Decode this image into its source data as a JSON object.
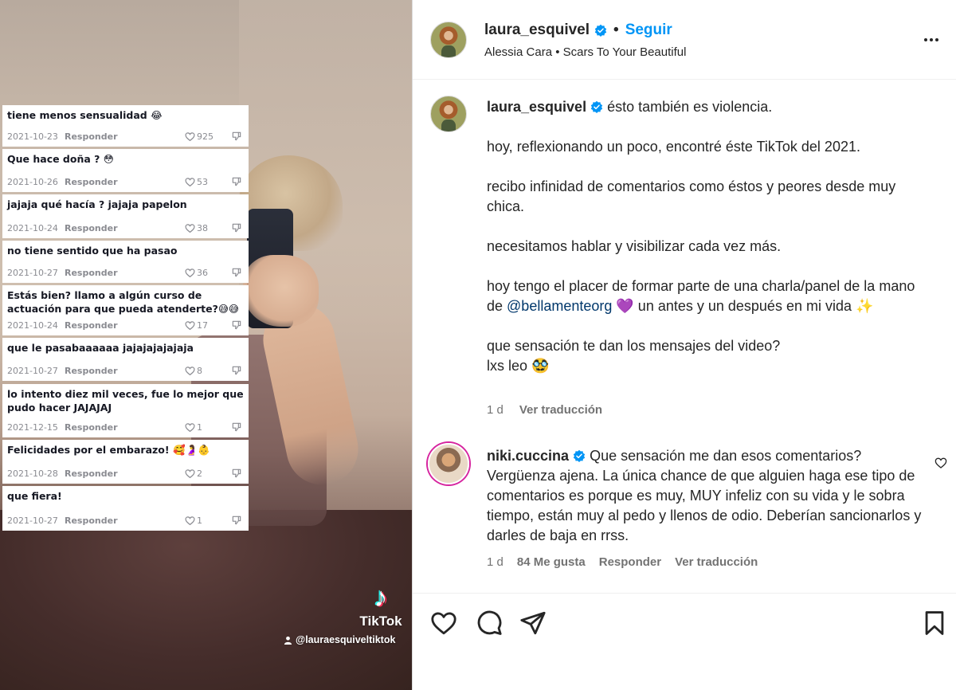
{
  "video": {
    "tiktok_brand": "TikTok",
    "tiktok_handle": "@lauraesquiveltiktok",
    "comments": [
      {
        "text": "tiene menos sensualidad 😂",
        "date": "2021-10-23",
        "reply": "Responder",
        "likes": "925"
      },
      {
        "text": "Que hace doña ? 😳",
        "date": "2021-10-26",
        "reply": "Responder",
        "likes": "53"
      },
      {
        "text": "jajaja qué hacía ? jajaja papelon",
        "date": "2021-10-24",
        "reply": "Responder",
        "likes": "38"
      },
      {
        "text": "no tiene sentido que ha pasao",
        "date": "2021-10-27",
        "reply": "Responder",
        "likes": "36"
      },
      {
        "text": "Estás bien? llamo a algún curso de actuación para que pueda atenderte?😅😅",
        "date": "2021-10-24",
        "reply": "Responder",
        "likes": "17"
      },
      {
        "text": "que le pasabaaaaaa jajajajajajaja",
        "date": "2021-10-27",
        "reply": "Responder",
        "likes": "8"
      },
      {
        "text": "lo intento diez mil veces, fue lo mejor que pudo hacer JAJAJAJ",
        "date": "2021-12-15",
        "reply": "Responder",
        "likes": "1"
      },
      {
        "text": "Felicidades por el embarazo! 🥰🤰👶",
        "date": "2021-10-28",
        "reply": "Responder",
        "likes": "2"
      },
      {
        "text": "que fiera!",
        "date": "2021-10-27",
        "reply": "Responder",
        "likes": "1"
      }
    ]
  },
  "header": {
    "username": "laura_esquivel",
    "separator": "•",
    "follow_label": "Seguir",
    "audio": "Alessia Cara • Scars To Your Beautiful"
  },
  "caption": {
    "username": "laura_esquivel",
    "line1": "ésto también es violencia.",
    "p2": "hoy, reflexionando un poco, encontré éste TikTok del 2021.",
    "p3": "recibo infinidad de comentarios como éstos y peores desde muy chica.",
    "p4": "necesitamos hablar y visibilizar cada vez más.",
    "p5a": "hoy tengo el placer de formar parte de una charla/panel de la mano de ",
    "mention": "@bellamenteorg",
    "p5b": " 💜 un antes y un después en mi vida ✨",
    "p6a": "que sensación te dan los mensajes del video?",
    "p6b": "lxs leo 🥸",
    "time": "1 d",
    "translate": "Ver traducción"
  },
  "comment": {
    "username": "niki.cuccina",
    "text": "Que sensación me dan esos comentarios? Vergüenza ajena. La única chance de que alguien haga ese tipo de comentarios es porque es muy, MUY infeliz con su vida y le sobra tiempo, están muy al pedo y llenos de odio. Deberían sancionarlos y darles de baja en rrss.",
    "time": "1 d",
    "likes": "84 Me gusta",
    "reply": "Responder",
    "translate": "Ver traducción"
  },
  "colors": {
    "link": "#0095f6",
    "mention": "#00376b",
    "verified": "#0095f6"
  }
}
